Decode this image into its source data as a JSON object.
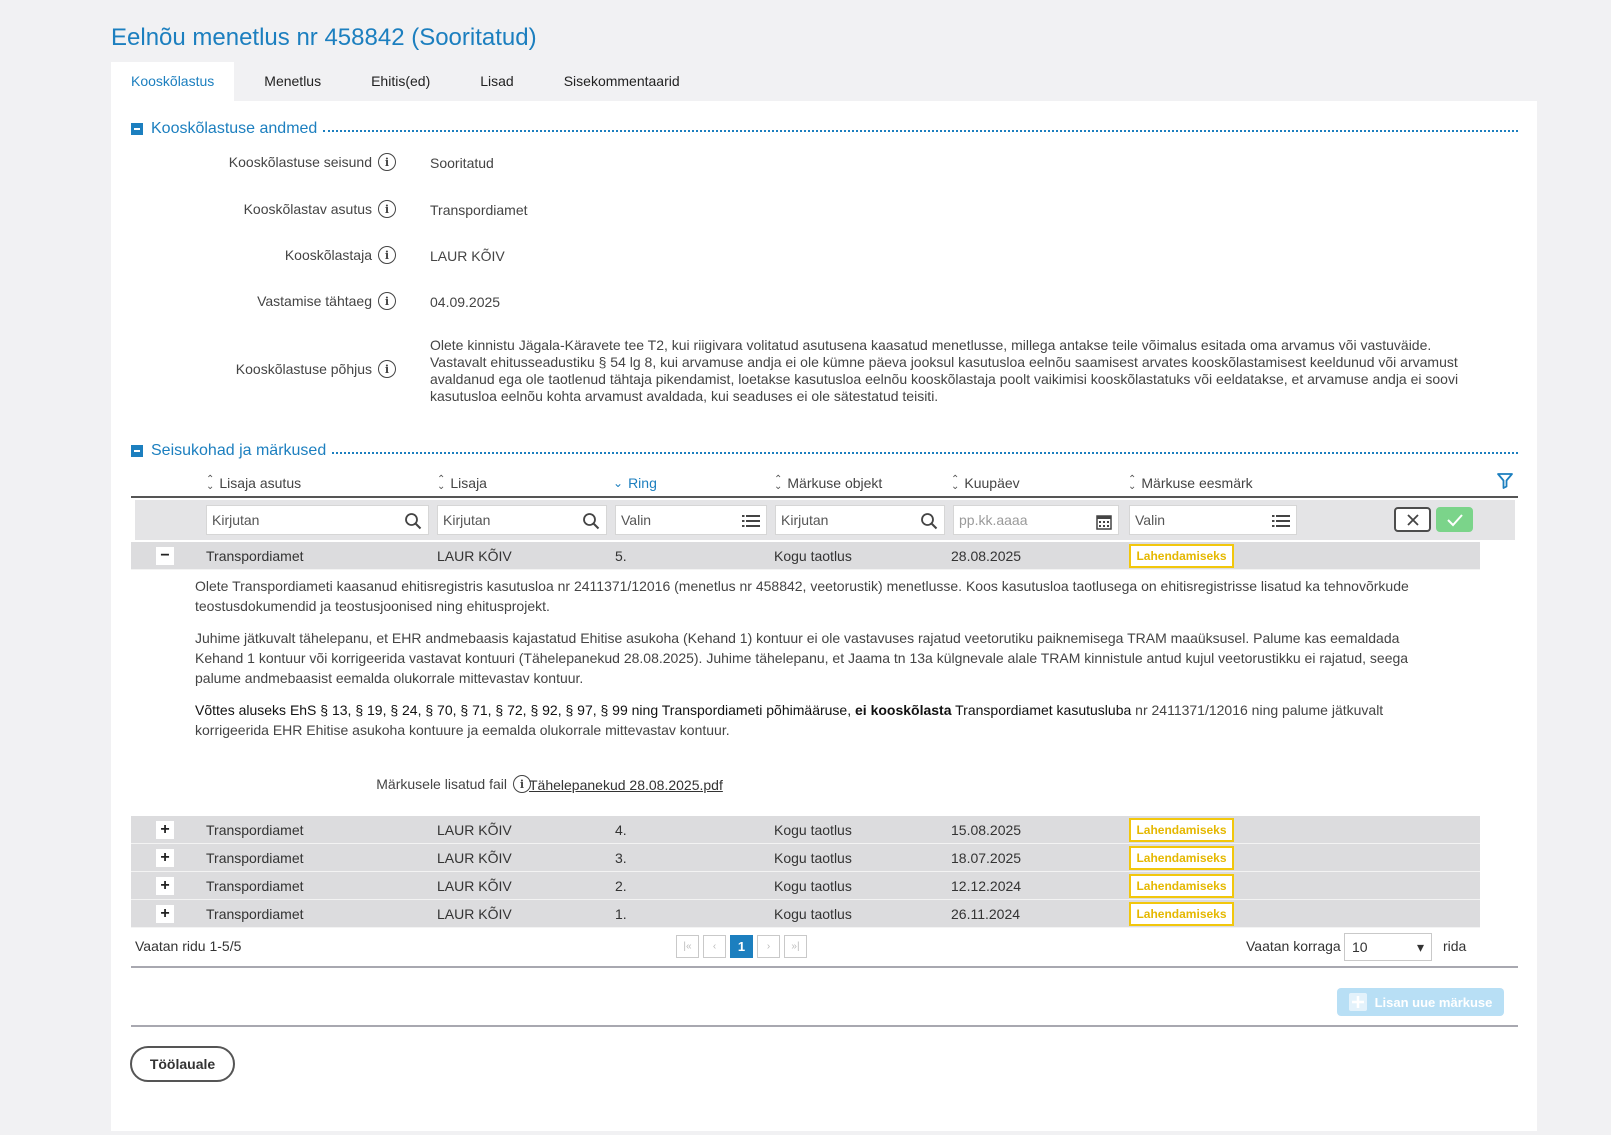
{
  "page": {
    "title": "Eelnõu menetlus nr 458842 (Sooritatud)"
  },
  "tabs": [
    {
      "label": "Kooskõlastus"
    },
    {
      "label": "Menetlus"
    },
    {
      "label": "Ehitis(ed)"
    },
    {
      "label": "Lisad"
    },
    {
      "label": "Sisekommentaarid"
    }
  ],
  "section1": {
    "title": "Kooskõlastuse andmed",
    "fields": [
      {
        "label": "Kooskõlastuse seisund",
        "value": "Sooritatud"
      },
      {
        "label": "Kooskõlastav asutus",
        "value": "Transpordiamet"
      },
      {
        "label": "Kooskõlastaja",
        "value": "LAUR KÕIV"
      },
      {
        "label": "Vastamise tähtaeg",
        "value": "04.09.2025"
      },
      {
        "label": "Kooskõlastuse põhjus",
        "value": "Olete kinnistu Jägala-Käravete tee T2, kui riigivara volitatud asutusena kaasatud menetlusse, millega antakse teile võimalus esitada oma arvamus või vastuväide. Vastavalt ehitusseadustiku § 54 lg 8, kui arvamuse andja ei ole kümne päeva jooksul kasutusloa eelnõu saamisest arvates kooskõlastamisest keeldunud või arvamust avaldanud ega ole taotlenud tähtaja pikendamist, loetakse kasutusloa eelnõu kooskõlastaja poolt vaikimisi kooskõlastatuks või eeldatakse, et arvamuse andja ei soovi kasutusloa eelnõu kohta arvamust avaldada, kui seaduses ei ole sätestatud teisiti."
      }
    ]
  },
  "section2": {
    "title": "Seisukohad ja märkused",
    "columns": [
      "Lisaja asutus",
      "Lisaja",
      "Ring",
      "Märkuse objekt",
      "Kuupäev",
      "Märkuse eesmärk"
    ],
    "filters": {
      "asutus": "Kirjutan",
      "lisaja": "Kirjutan",
      "ring": "Valin",
      "objekt": "Kirjutan",
      "kuupaev": "pp.kk.aaaa",
      "eesmark": "Valin"
    },
    "rows": [
      {
        "asutus": "Transpordiamet",
        "lisaja": "LAUR KÕIV",
        "ring": "5.",
        "objekt": "Kogu taotlus",
        "kuupaev": "28.08.2025",
        "eesmark": "Lahendamiseks",
        "expanded": true
      },
      {
        "asutus": "Transpordiamet",
        "lisaja": "LAUR KÕIV",
        "ring": "4.",
        "objekt": "Kogu taotlus",
        "kuupaev": "15.08.2025",
        "eesmark": "Lahendamiseks"
      },
      {
        "asutus": "Transpordiamet",
        "lisaja": "LAUR KÕIV",
        "ring": "3.",
        "objekt": "Kogu taotlus",
        "kuupaev": "18.07.2025",
        "eesmark": "Lahendamiseks"
      },
      {
        "asutus": "Transpordiamet",
        "lisaja": "LAUR KÕIV",
        "ring": "2.",
        "objekt": "Kogu taotlus",
        "kuupaev": "12.12.2024",
        "eesmark": "Lahendamiseks"
      },
      {
        "asutus": "Transpordiamet",
        "lisaja": "LAUR KÕIV",
        "ring": "1.",
        "objekt": "Kogu taotlus",
        "kuupaev": "26.11.2024",
        "eesmark": "Lahendamiseks"
      }
    ],
    "details": {
      "p1": "Olete Transpordiameti kaasanud ehitisregistris kasutusloa nr 2411371/12016 (menetlus nr 458842, veetorustik) menetlusse. Koos kasutusloa taotlusega on ehitisregistrisse lisatud ka tehnovõrkude teostusdokumendid ja teostusjoonised ning ehitusprojekt.",
      "p2": "Juhime jätkuvalt tähelepanu, et EHR andmebaasis kajastatud Ehitise asukoha (Kehand 1) kontuur ei ole vastavuses rajatud veetorutiku paiknemisega TRAM maaüksusel. Palume kas eemaldada Kehand 1 kontuur või korrigeerida vastavat kontuuri (Tähelepanekud 28.08.2025). Juhime tähelepanu, et Jaama tn 13a külgnevale alale TRAM kinnistule antud kujul veetorustikku ei rajatud, seega palume andmebaasist eemalda olukorrale mittevastav kontuur.",
      "p3a": "Võttes aluseks EhS § 13, § 19, § 24, § 70, § 71, § 72, § 92, § 97, § 99 ning Transpordiameti põhimääruse, ",
      "p3b": "ei kooskõlasta",
      "p3c": " Transpordiamet kasutusluba",
      "p3d": " nr 2411371/12016 ning palume jätkuvalt korrigeerida EHR Ehitise asukoha kontuure ja eemalda olukorrale mittevastav kontuur.",
      "attach_label": "Märkusele lisatud fail",
      "attach_file": "Tähelepanekud 28.08.2025.pdf"
    },
    "pager": {
      "summary": "Vaatan ridu 1-5/5",
      "current_page": "1",
      "per_page_label": "Vaatan korraga",
      "per_page_value": "10",
      "per_page_suffix": "rida"
    },
    "add_button": "Lisan uue märkuse"
  },
  "back_button": "Töölauale",
  "colors": {
    "accent": "#1c7fbf",
    "badge": "#f2c70c",
    "apply": "#7bd48a"
  }
}
